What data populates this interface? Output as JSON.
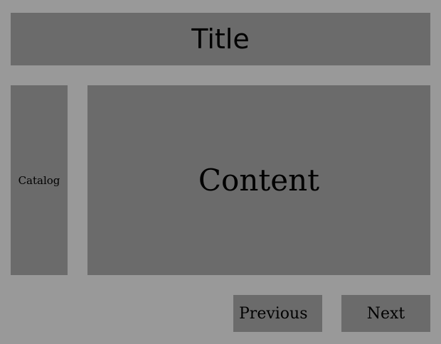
{
  "header": {
    "title": "Title"
  },
  "sidebar": {
    "label": "Catalog"
  },
  "main": {
    "label": "Content"
  },
  "nav": {
    "previous_label": "Previous",
    "next_label": "Next"
  },
  "colors": {
    "background": "#999999",
    "panel": "#6b6b6b",
    "text": "#000000"
  }
}
